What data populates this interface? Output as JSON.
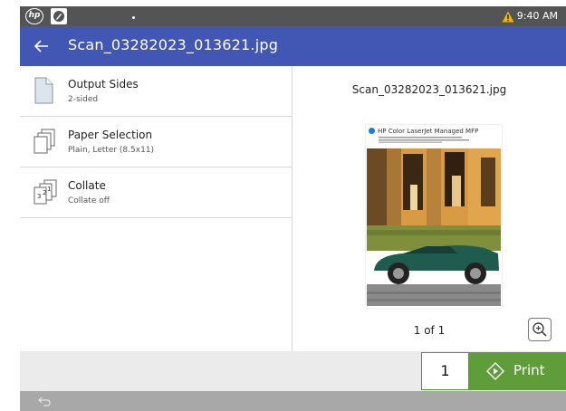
{
  "status_bar": {
    "time": "9:40 AM",
    "logo_text": "hp",
    "icons": [
      "hp-logo-icon",
      "app-icon",
      "warning-icon"
    ],
    "warning_color": "#f2b600"
  },
  "app_bar": {
    "title": "Scan_03282023_013621.jpg",
    "background": "#4256b4"
  },
  "settings": {
    "items": [
      {
        "label": "Output Sides",
        "value": "2-sided",
        "icon": "document-icon"
      },
      {
        "label": "Paper Selection",
        "value": "Plain, Letter (8.5x11)",
        "icon": "paper-stack-icon"
      },
      {
        "label": "Collate",
        "value": "Collate off",
        "icon": "collate-icon"
      }
    ]
  },
  "preview": {
    "filename": "Scan_03282023_013621.jpg",
    "doc_header": "HP Color LaserJet Managed MFP",
    "page_indicator": "1 of 1",
    "zoom_icon": "zoom-in-icon"
  },
  "footer": {
    "copies": "1",
    "print_label": "Print",
    "print_color": "#5f9d3b"
  }
}
